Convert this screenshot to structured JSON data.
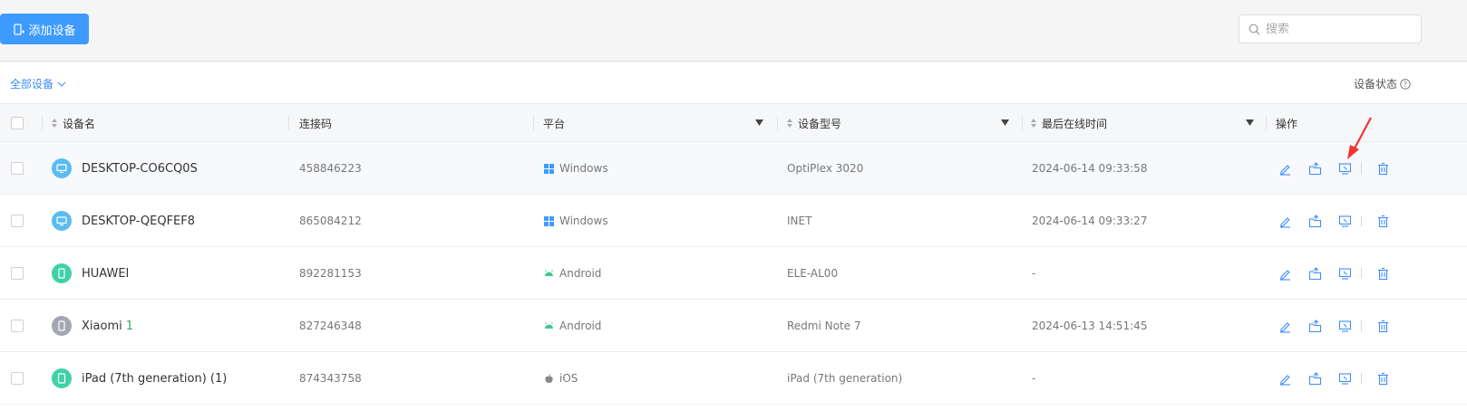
{
  "toolbar": {
    "add_device_label": "添加设备",
    "search_placeholder": "搜索"
  },
  "filter": {
    "all_devices_label": "全部设备",
    "device_status_label": "设备状态"
  },
  "table": {
    "columns": {
      "name": "设备名",
      "code": "连接码",
      "platform": "平台",
      "model": "设备型号",
      "last_online": "最后在线时间",
      "actions": "操作"
    },
    "rows": [
      {
        "name": "DESKTOP-CO6CQ0S",
        "name_badge": "",
        "avatar": "monitor-icon",
        "avatar_color": "#5bbcf2",
        "code": "458846223",
        "platform": "Windows",
        "platform_icon": "windows-icon",
        "model": "OptiPlex 3020",
        "last_online": "2024-06-14 09:33:58"
      },
      {
        "name": "DESKTOP-QEQFEF8",
        "name_badge": "",
        "avatar": "monitor-icon",
        "avatar_color": "#5bbcf2",
        "code": "865084212",
        "platform": "Windows",
        "platform_icon": "windows-icon",
        "model": "INET",
        "last_online": "2024-06-14 09:33:27"
      },
      {
        "name": "HUAWEI",
        "name_badge": "",
        "avatar": "phone-icon",
        "avatar_color": "#3fd1a8",
        "code": "892281153",
        "platform": "Android",
        "platform_icon": "android-icon",
        "model": "ELE-AL00",
        "last_online": "-"
      },
      {
        "name": "Xiaomi",
        "name_badge": "1",
        "avatar": "phone-icon",
        "avatar_color": "#a3a7b3",
        "code": "827246348",
        "platform": "Android",
        "platform_icon": "android-icon",
        "model": "Redmi Note 7",
        "last_online": "2024-06-13 14:51:45"
      },
      {
        "name": "iPad (7th generation) (1)",
        "name_badge": "",
        "avatar": "tablet-icon",
        "avatar_color": "#3fd1a8",
        "code": "874343758",
        "platform": "iOS",
        "platform_icon": "apple-icon",
        "model": "iPad (7th generation)",
        "last_online": "-"
      }
    ]
  },
  "colors": {
    "accent": "#3d9bff",
    "arrow": "#f0352f"
  }
}
